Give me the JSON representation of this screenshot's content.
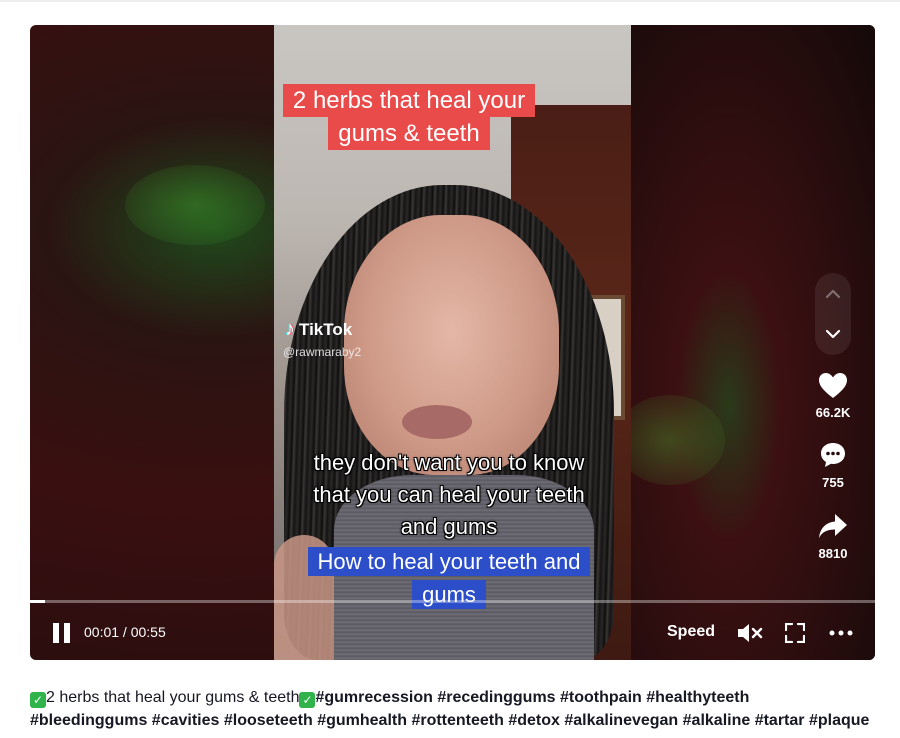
{
  "video": {
    "caption_top": "2 herbs that heal your gums & teeth",
    "caption_middle": "they don't want you to know that you can heal your teeth and gums",
    "caption_bottom": "How to heal your teeth and gums",
    "watermark_brand": "TikTok",
    "watermark_handle": "@rawmaraby2"
  },
  "actions": {
    "likes": "66.2K",
    "comments": "755",
    "shares": "8810"
  },
  "controls": {
    "time": "00:01 / 00:55",
    "speed_label": "Speed",
    "progress": 0.018
  },
  "description": {
    "check_glyph": "✓",
    "title": "2 herbs that heal your gums & teeth",
    "hashtags_line1": "#gumrecession #recedinggums #toothpain #healthyteeth",
    "hashtags_line2": "#bleedinggums #cavities #looseteeth #gumhealth #rottenteeth #detox #alkalinevegan #alkaline #tartar #plaque"
  },
  "icons": [
    "chevron-up-icon",
    "chevron-down-icon",
    "heart-icon",
    "comment-icon",
    "share-icon",
    "pause-icon",
    "mute-icon",
    "fullscreen-icon",
    "more-icon"
  ],
  "colors": {
    "caption_red": "#e94b4b",
    "caption_blue": "#2c4fc9",
    "check_green": "#2fb34a"
  }
}
